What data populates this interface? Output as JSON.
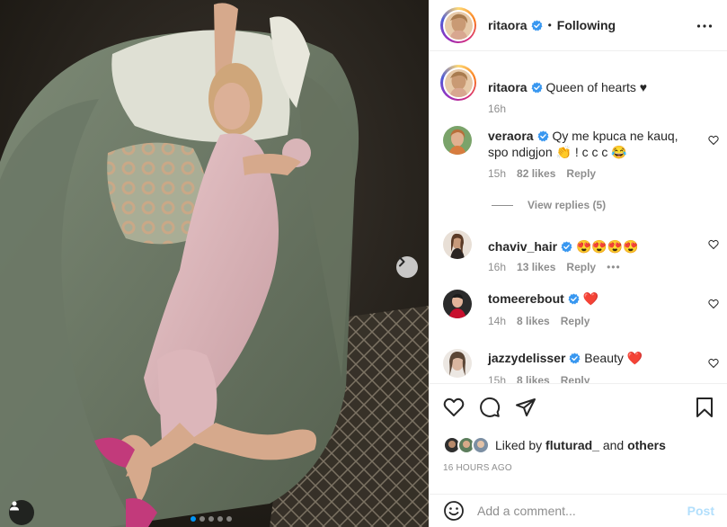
{
  "post": {
    "username": "ritaora",
    "separator": "•",
    "follow_status": "Following",
    "caption": {
      "username": "ritaora",
      "text": "Queen of hearts ♥",
      "time": "16h"
    }
  },
  "comments": [
    {
      "username": "veraora",
      "verified": true,
      "text_line1": "Qy me kpuca ne kauq,",
      "text_line2": "spo ndigjon 👏 ! c c c 😂",
      "time": "15h",
      "likes": "82 likes",
      "reply": "Reply",
      "view_replies": "View replies (5)"
    },
    {
      "username": "chaviv_hair",
      "verified": true,
      "text": "😍😍😍😍",
      "time": "16h",
      "likes": "13 likes",
      "reply": "Reply",
      "more": "•••"
    },
    {
      "username": "tomeerebout",
      "verified": true,
      "text": "❤️",
      "time": "14h",
      "likes": "8 likes",
      "reply": "Reply"
    },
    {
      "username": "jazzydelisser",
      "verified": true,
      "text": "Beauty ❤️",
      "time": "15h",
      "likes": "8 likes",
      "reply": "Reply"
    }
  ],
  "likes_summary": {
    "prefix": "Liked by",
    "user": "fluturad_",
    "connector": "and",
    "others": "others"
  },
  "timestamp": "16 HOURS AGO",
  "add_comment": {
    "placeholder": "Add a comment...",
    "post_label": "Post"
  },
  "carousel": {
    "total": 5,
    "active_index": 0
  },
  "colors": {
    "verified": "#3897f0",
    "heart_red": "#ed4956",
    "post_disabled": "#b2dffc",
    "active_dot": "#0095f6"
  },
  "icons": [
    "more-icon",
    "heart-icon",
    "comment-icon",
    "share-icon",
    "bookmark-icon",
    "emoji-icon",
    "chevron-right-icon",
    "user-tag-icon",
    "verified-badge-icon"
  ]
}
